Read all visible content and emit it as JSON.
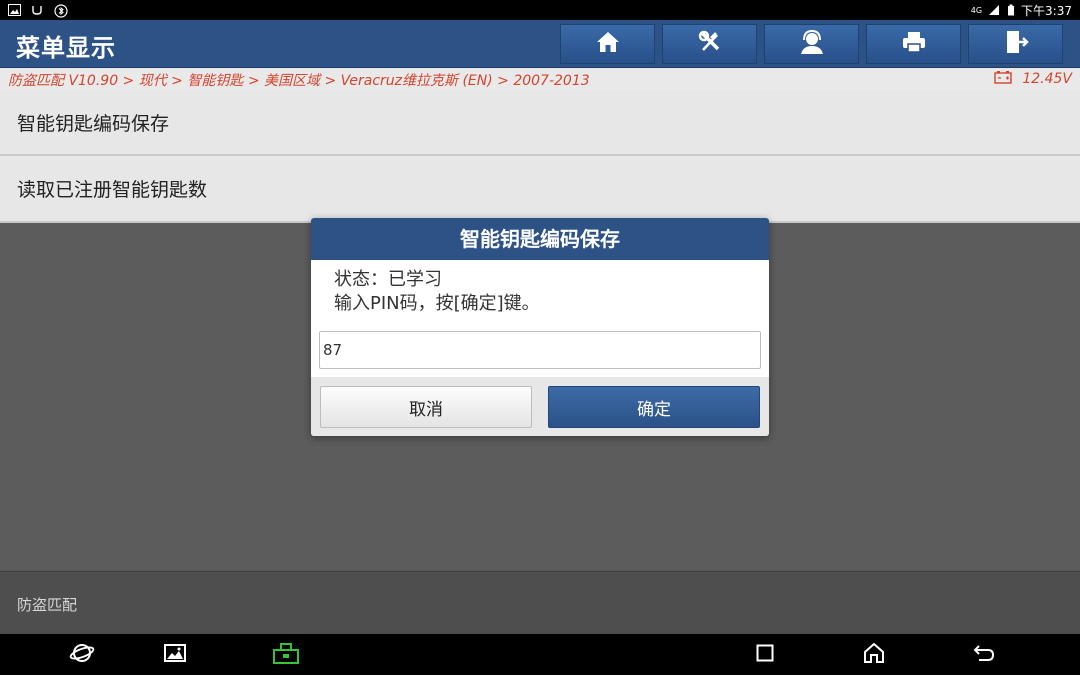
{
  "status_bar": {
    "time": "下午3:37",
    "network": "4G"
  },
  "header": {
    "title": "菜单显示",
    "toolbar": [
      {
        "icon": "home-icon"
      },
      {
        "icon": "tools-icon"
      },
      {
        "icon": "support-icon"
      },
      {
        "icon": "printer-icon"
      },
      {
        "icon": "exit-icon"
      }
    ]
  },
  "breadcrumb": {
    "path": "防盗匹配 V10.90 > 现代 > 智能钥匙 > 美国区域 > Veracruz维拉克斯 (EN) > 2007-2013",
    "voltage": "12.45V"
  },
  "menu": {
    "items": [
      {
        "label": "智能钥匙编码保存"
      },
      {
        "label": "读取已注册智能钥匙数"
      }
    ]
  },
  "dialog": {
    "title": "智能钥匙编码保存",
    "status_line": "状态：已学习",
    "instruction": "输入PIN码，按[确定]键。",
    "input_value": "87",
    "cancel_label": "取消",
    "ok_label": "确定"
  },
  "footer": {
    "label": "防盗匹配"
  },
  "colors": {
    "header_bg": "#2d5286",
    "accent_text": "#d2452f",
    "ok_button": "#2b5288"
  }
}
